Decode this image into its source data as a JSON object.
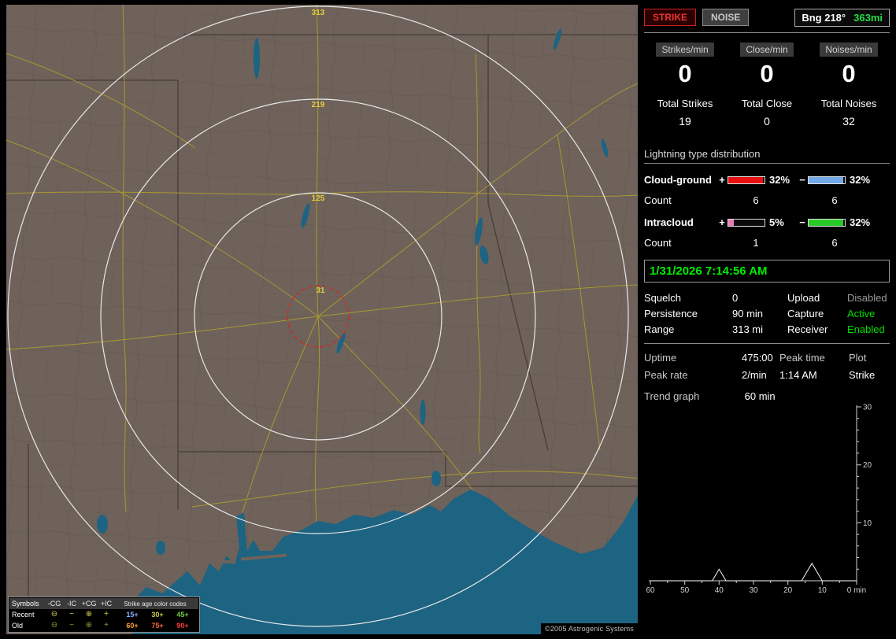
{
  "colors": {
    "accent_green": "#00dd00",
    "strike_red": "#dd2222",
    "panel_bg": "#000000",
    "map_land": "#6e625b",
    "map_water": "#1d6382",
    "road_yellow": "#b3a328",
    "ring_white": "#e8e8e8",
    "ring_label_yellow": "#e3cf3f"
  },
  "map": {
    "ring_labels": [
      "313",
      "219",
      "125",
      "31"
    ],
    "copyright": "©2005 Astrogenic Systems",
    "legend": {
      "symbols_header": "Symbols",
      "symbol_columns": [
        "-CG",
        "-IC",
        "+CG",
        "+IC"
      ],
      "age_header": "Strike age color codes",
      "rows": [
        {
          "label": "Recent",
          "glyphs": [
            "⊖",
            "−",
            "⊕",
            "+"
          ],
          "ages": [
            {
              "text": "15+",
              "style": "color:#8cb4ff"
            },
            {
              "text": "30+",
              "style": "color:#cdd24a"
            },
            {
              "text": "45+",
              "style": "color:#6fcf4a"
            }
          ]
        },
        {
          "label": "Old",
          "glyphs": [
            "⊖",
            "−",
            "⊕",
            "+"
          ],
          "ages": [
            {
              "text": "60+",
              "style": "color:#ffa040"
            },
            {
              "text": "75+",
              "style": "color:#ff6a3a"
            },
            {
              "text": "90+",
              "style": "color:#ff3a3a"
            }
          ]
        }
      ]
    }
  },
  "panel": {
    "strike_button": "STRIKE",
    "noise_button": "NOISE",
    "bearing": "Bng 218°",
    "bearing_distance": "363mi",
    "rates": [
      {
        "label": "Strikes/min",
        "value": "0"
      },
      {
        "label": "Close/min",
        "value": "0"
      },
      {
        "label": "Noises/min",
        "value": "0"
      }
    ],
    "totals": [
      {
        "label": "Total Strikes",
        "value": "19"
      },
      {
        "label": "Total Close",
        "value": "0"
      },
      {
        "label": "Total Noises",
        "value": "32"
      }
    ],
    "distribution": {
      "heading": "Lightning type distribution",
      "count_label": "Count",
      "rows": [
        {
          "label": "Cloud-ground",
          "plus_sign": "+",
          "minus_sign": "−",
          "pos_pct": "32%",
          "neg_pct": "32%",
          "pos_count": "6",
          "neg_count": "6",
          "pos_style": "width:96%;background:#e81010",
          "neg_style": "width:96%;background:#74a9e8"
        },
        {
          "label": "Intracloud",
          "plus_sign": "+",
          "minus_sign": "−",
          "pos_pct": "5%",
          "neg_pct": "32%",
          "pos_count": "1",
          "neg_count": "6",
          "pos_style": "width:15%;background:#e87ab8",
          "neg_style": "width:96%;background:#28c828"
        }
      ]
    },
    "datetime": "1/31/2026 7:14:56 AM",
    "settings": {
      "rows": [
        {
          "l1": "Squelch",
          "v1": "0",
          "l2": "Upload",
          "v2": "Disabled",
          "v2_state": "dim"
        },
        {
          "l1": "Persistence",
          "v1": "90 min",
          "l2": "Capture",
          "v2": "Active",
          "v2_state": "green"
        },
        {
          "l1": "Range",
          "v1": "313 mi",
          "l2": "Receiver",
          "v2": "Enabled",
          "v2_state": "green"
        }
      ]
    },
    "stats": {
      "uptime_label": "Uptime",
      "uptime_value": "475:00",
      "peak_time_label": "Peak time",
      "peak_time_value": "1:14 AM",
      "plot_label": "Plot",
      "plot_value": "Strike",
      "peak_rate_label": "Peak rate",
      "peak_rate_value": "2/min"
    },
    "trend": {
      "label": "Trend graph",
      "value": "60 min"
    }
  },
  "chart_data": {
    "type": "line",
    "title": "Trend graph",
    "xlabel": "min",
    "x_axis_direction": "minutes ago, 60 at left to 0 at right",
    "ylim": [
      0,
      30
    ],
    "x": [
      60,
      42,
      40,
      38,
      16,
      13,
      10,
      0
    ],
    "series": [
      {
        "name": "Strike",
        "values": [
          0,
          0,
          2,
          0,
          0,
          3,
          0,
          0
        ]
      }
    ],
    "x_tick_labels": [
      "60",
      "50",
      "40",
      "30",
      "20",
      "10",
      "0 min"
    ],
    "y_tick_labels": [
      "30",
      "20",
      "10"
    ],
    "grid": false,
    "legend_position": "none"
  }
}
